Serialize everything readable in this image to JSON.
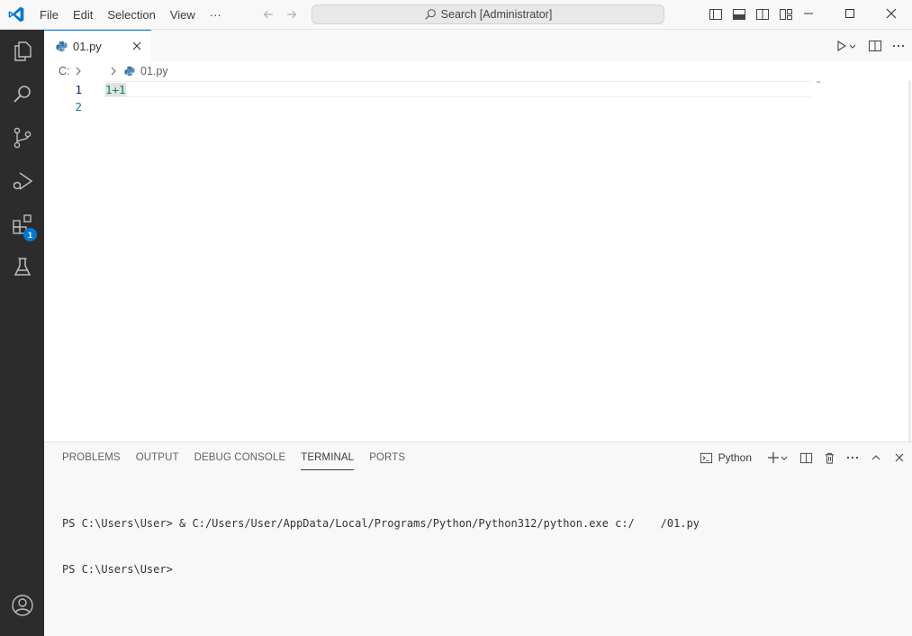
{
  "menu": [
    "File",
    "Edit",
    "Selection",
    "View",
    "···"
  ],
  "search": {
    "text": "Search [Administrator]"
  },
  "activity": {
    "extensions_badge": "1"
  },
  "tab": {
    "name": "01.py"
  },
  "breadcrumb": {
    "drive": "C:",
    "file": "01.py"
  },
  "editor": {
    "lines": [
      {
        "number": "1",
        "text": "1+1"
      },
      {
        "number": "2",
        "text": ""
      }
    ]
  },
  "panel": {
    "tabs": [
      "PROBLEMS",
      "OUTPUT",
      "DEBUG CONSOLE",
      "TERMINAL",
      "PORTS"
    ],
    "active_tab": "TERMINAL",
    "terminal_name": "Python"
  },
  "terminal": {
    "lines": [
      "PS C:\\Users\\User> & C:/Users/User/AppData/Local/Programs/Python/Python312/python.exe c:/    /01.py",
      "PS C:\\Users\\User>"
    ]
  },
  "colors": {
    "accent": "#0078d4",
    "activity_bar": "#2c2c2c",
    "number": "#098658"
  }
}
